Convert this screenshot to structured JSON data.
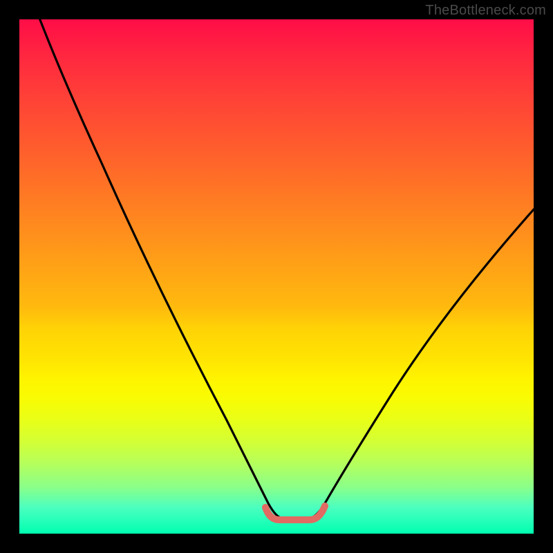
{
  "watermark": "TheBottleneck.com",
  "chart_data": {
    "type": "line",
    "title": "",
    "xlabel": "",
    "ylabel": "",
    "xlim": [
      0,
      100
    ],
    "ylim": [
      0,
      100
    ],
    "grid": false,
    "series": [
      {
        "name": "bottleneck-curve",
        "x": [
          3,
          10,
          20,
          30,
          40,
          45,
          48,
          52,
          56,
          58,
          62,
          70,
          80,
          90,
          100
        ],
        "y": [
          103,
          85,
          66,
          48,
          29,
          19,
          10,
          3,
          3,
          7,
          13,
          24,
          38,
          51,
          63
        ]
      }
    ],
    "flat_zone": {
      "x_start": 48,
      "x_end": 57,
      "y": 3
    },
    "colors": {
      "curve": "#000000",
      "flat_marker": "#e16a62",
      "gradient_top": "#ff0d47",
      "gradient_bottom": "#00ffb0",
      "background": "#000000"
    }
  }
}
